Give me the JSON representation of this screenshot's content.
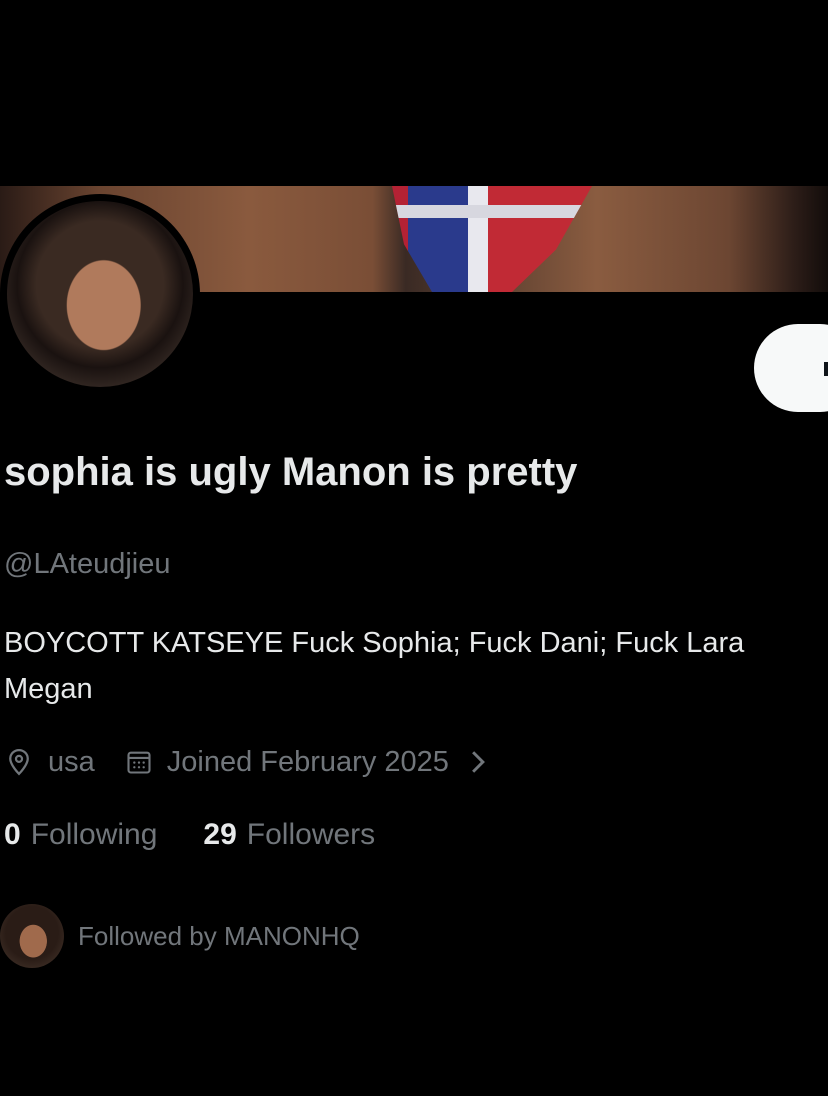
{
  "profile": {
    "display_name": "sophia is ugly Manon is pretty",
    "handle": "@LAteudjieu",
    "bio_line1": "BOYCOTT KATSEYE Fuck Sophia; Fuck Dani; Fuck Lara",
    "bio_line2": "Megan",
    "location": "usa",
    "joined": "Joined February 2025",
    "following_count": "0",
    "following_label": "Following",
    "followers_count": "29",
    "followers_label": "Followers",
    "followed_by": "Followed by MANONHQ"
  },
  "icons": {
    "location": "location-pin-icon",
    "calendar": "calendar-icon",
    "chevron": "chevron-right-icon"
  },
  "colors": {
    "background": "#000000",
    "primary_text": "#e7e9ea",
    "secondary_text": "#71767b",
    "button_bg": "#f7f9f9"
  }
}
